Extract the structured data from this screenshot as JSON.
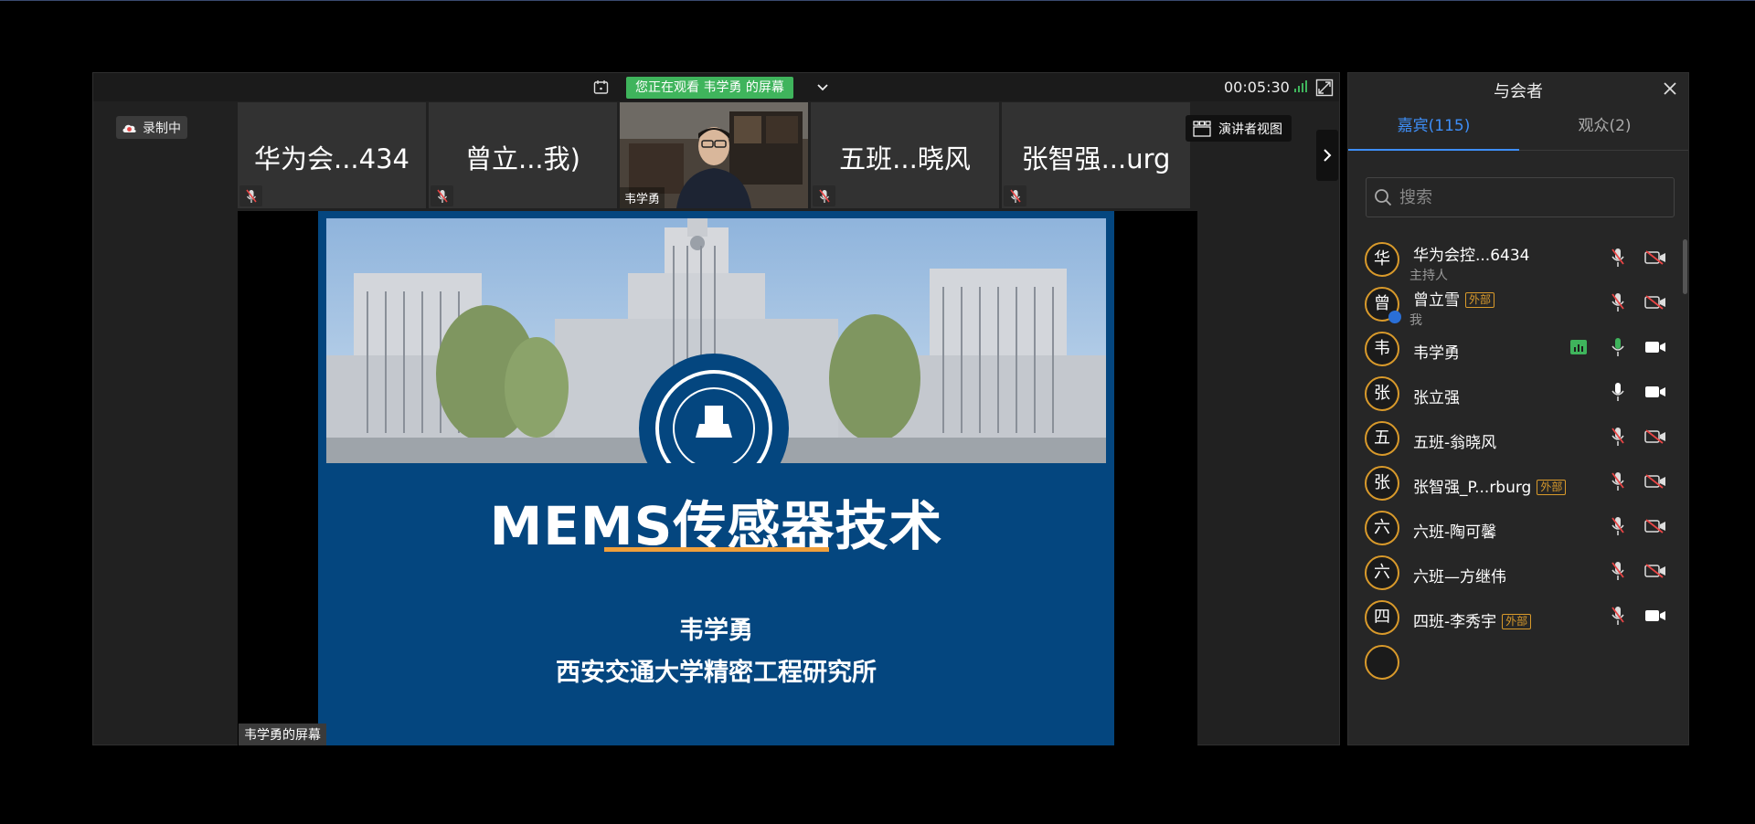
{
  "toolbar": {
    "watching_text": "您正在观看 韦学勇 的屏幕",
    "timer": "00:05:30"
  },
  "recording": {
    "label": "录制中"
  },
  "presenter_view": {
    "label": "演讲者视图"
  },
  "thumbnails": [
    {
      "name": "华为会...434",
      "muted": true
    },
    {
      "name": "曾立...我)",
      "muted": true
    },
    {
      "name": "韦学勇",
      "video": true
    },
    {
      "name": "五班...晓风",
      "muted": true
    },
    {
      "name": "张智强...urg",
      "muted": true
    }
  ],
  "shared_screen": {
    "label": "韦学勇的屏幕",
    "slide_title": "MEMS传感器技术",
    "slide_author": "韦学勇",
    "slide_institution": "西安交通大学精密工程研究所"
  },
  "panel": {
    "title": "与会者",
    "tabs": [
      {
        "label": "嘉宾(115)",
        "active": true
      },
      {
        "label": "观众(2)",
        "active": false
      }
    ],
    "search_placeholder": "搜索",
    "participants": [
      {
        "avatar": "华",
        "name": "华为会控...6434",
        "sub": "主持人",
        "external": false,
        "mic": "muted",
        "cam": "off"
      },
      {
        "avatar": "曾",
        "name": "曾立雪",
        "sub": "我",
        "external": true,
        "mic": "muted",
        "cam": "off"
      },
      {
        "avatar": "韦",
        "name": "韦学勇",
        "sub": "",
        "external": false,
        "mic": "on-green",
        "cam": "on",
        "sharing": true
      },
      {
        "avatar": "张",
        "name": "张立强",
        "sub": "",
        "external": false,
        "mic": "on",
        "cam": "on"
      },
      {
        "avatar": "五",
        "name": "五班-翁晓风",
        "sub": "",
        "external": false,
        "mic": "muted",
        "cam": "off"
      },
      {
        "avatar": "张",
        "name": "张智强_P...rburg",
        "sub": "",
        "external": true,
        "mic": "muted",
        "cam": "off"
      },
      {
        "avatar": "六",
        "name": "六班-陶可馨",
        "sub": "",
        "external": false,
        "mic": "muted",
        "cam": "off"
      },
      {
        "avatar": "六",
        "name": "六班—方继伟",
        "sub": "",
        "external": false,
        "mic": "muted",
        "cam": "off"
      },
      {
        "avatar": "四",
        "name": "四班-李秀宇",
        "sub": "",
        "external": true,
        "mic": "muted",
        "cam": "on"
      }
    ],
    "external_tag": "外部"
  },
  "colors": {
    "accent_blue": "#3e8ef7",
    "badge_green": "#3fb45c",
    "slide_blue": "#04467f",
    "avatar_ring": "#d99a2b",
    "underline_orange": "#f0a03c"
  }
}
